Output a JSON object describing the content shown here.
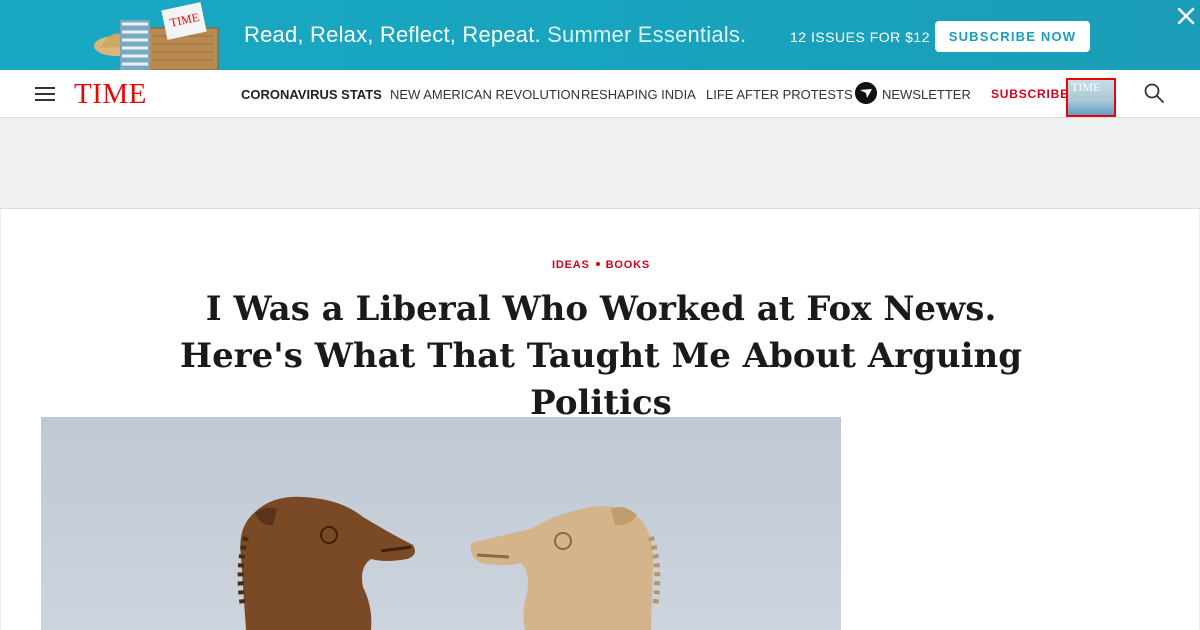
{
  "promo": {
    "tagline": "Read, Relax, Reflect, Repeat.",
    "tagline_light": "Summer Essentials.",
    "offer": "12 ISSUES FOR $12",
    "button_label": "SUBSCRIBE NOW",
    "background_color": "#19a6c0",
    "close_icon": "close-icon"
  },
  "header": {
    "logo": "TIME",
    "logo_color": "#e90606",
    "nav": [
      {
        "label": "CORONAVIRUS STATS",
        "bold": true
      },
      {
        "label": "NEW AMERICAN REVOLUTION",
        "bold": false
      },
      {
        "label": "RESHAPING INDIA",
        "bold": false
      },
      {
        "label": "LIFE AFTER PROTESTS",
        "bold": false
      },
      {
        "label": "NEWSLETTER",
        "bold": false
      }
    ],
    "subscribe_label": "SUBSCRIBE",
    "cover_logo": "TIME",
    "menu_icon": "hamburger-icon",
    "search_icon": "search-icon"
  },
  "article": {
    "tags": [
      "IDEAS",
      "BOOKS"
    ],
    "headline": "I Was a Liberal Who Worked at Fox News. Here's What That Taught Me About Arguing Politics",
    "hero_image": "two-chess-knights-facing"
  }
}
